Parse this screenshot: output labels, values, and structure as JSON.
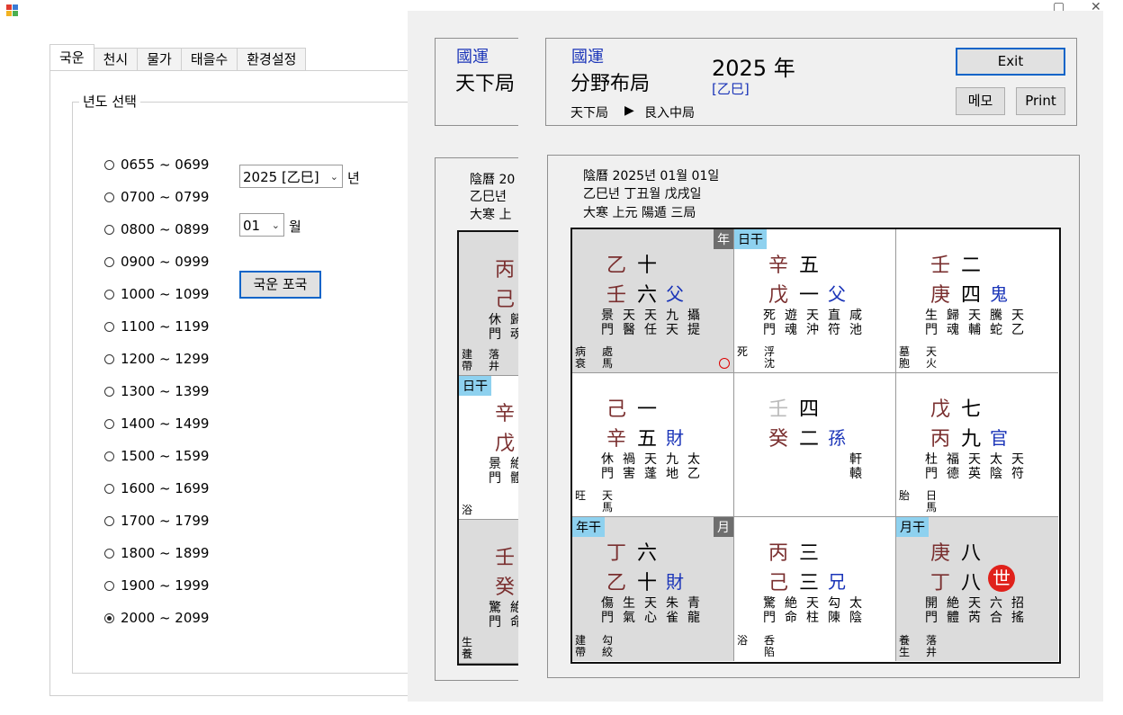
{
  "tabs": [
    "국운",
    "천시",
    "물가",
    "태을수",
    "환경설정"
  ],
  "group_title": "년도 선택",
  "ranges": [
    "0655 ~ 0699",
    "0700 ~ 0799",
    "0800 ~ 0899",
    "0900 ~ 0999",
    "1000 ~ 1099",
    "1100 ~ 1199",
    "1200 ~ 1299",
    "1300 ~ 1399",
    "1400 ~ 1499",
    "1500 ~ 1599",
    "1600 ~ 1699",
    "1700 ~ 1799",
    "1800 ~ 1899",
    "1900 ~ 1999",
    "2000 ~ 2099"
  ],
  "year_select": "2025 [乙巳]",
  "year_unit": "년",
  "month_select": "01",
  "month_unit": "월",
  "calc_button": "국운 포국",
  "back": {
    "title_small": "國運",
    "title_big": "天下局",
    "info1": "陰曆 20",
    "info2": "乙巳년",
    "info3": "大寒 上"
  },
  "front": {
    "title_small": "國運",
    "title_big": "分野布局",
    "year": "2025 年",
    "year_gz": "[乙巳]",
    "sub_left": "天下局",
    "sub_arrow": "▶",
    "sub_right": "艮入中局",
    "exit": "Exit",
    "memo": "메모",
    "print": "Print",
    "info1": "陰曆 2025년 01월 01일",
    "info2": "乙巳년 丁丑월 戊戌일",
    "info3": "大寒 上元 陽遁 三局"
  },
  "cells": [
    {
      "tagl": "",
      "tagr": "年",
      "s1": "乙",
      "n1": "十",
      "s2": "壬",
      "n2": "六",
      "rel": "父",
      "gods": [
        "景門",
        "天醫",
        "天任",
        "九天",
        "攝提"
      ],
      "foot": [
        "病衰",
        "處馬"
      ],
      "gray": true,
      "ring": true
    },
    {
      "tagl": "日干",
      "tagr": "",
      "s1": "辛",
      "n1": "五",
      "s2": "戊",
      "n2": "一",
      "rel": "父",
      "gods": [
        "死門",
        "遊魂",
        "天沖",
        "直符",
        "咸池"
      ],
      "foot": [
        "死",
        "浮沈"
      ],
      "gray": false
    },
    {
      "tagl": "",
      "tagr": "",
      "s1": "壬",
      "n1": "二",
      "s2": "庚",
      "n2": "四",
      "rel": "鬼",
      "gods": [
        "生門",
        "歸魂",
        "天輔",
        "騰蛇",
        "天乙"
      ],
      "foot": [
        "墓胞",
        "天火"
      ],
      "gray": false
    },
    {
      "tagl": "",
      "tagr": "",
      "s1": "己",
      "n1": "一",
      "s2": "辛",
      "n2": "五",
      "rel": "財",
      "gods": [
        "休門",
        "禍害",
        "天蓬",
        "九地",
        "太乙"
      ],
      "foot": [
        "旺",
        "天馬"
      ],
      "gray": false
    },
    {
      "tagl": "",
      "tagr": "",
      "s1": "壬",
      "n1": "四",
      "s2": "癸",
      "n2": "二",
      "rel": "孫",
      "gods": [
        "",
        "",
        "",
        "",
        "軒轅"
      ],
      "foot": [
        "",
        ""
      ],
      "gray": false,
      "center": true
    },
    {
      "tagl": "",
      "tagr": "",
      "s1": "戊",
      "n1": "七",
      "s2": "丙",
      "n2": "九",
      "rel": "官",
      "gods": [
        "杜門",
        "福德",
        "天英",
        "太陰",
        "天符"
      ],
      "foot": [
        "胎",
        "日馬"
      ],
      "gray": false
    },
    {
      "tagl": "年干",
      "tagr": "月",
      "s1": "丁",
      "n1": "六",
      "s2": "乙",
      "n2": "十",
      "rel": "財",
      "gods": [
        "傷門",
        "生氣",
        "天心",
        "朱雀",
        "青龍"
      ],
      "foot": [
        "建帶",
        "勾絞"
      ],
      "gray": true
    },
    {
      "tagl": "",
      "tagr": "",
      "s1": "丙",
      "n1": "三",
      "s2": "己",
      "n2": "三",
      "rel": "兄",
      "gods": [
        "驚門",
        "絶命",
        "天柱",
        "勾陳",
        "太陰"
      ],
      "foot": [
        "浴",
        "呑陷"
      ],
      "gray": false
    },
    {
      "tagl": "月干",
      "tagr": "",
      "s1": "庚",
      "n1": "八",
      "s2": "丁",
      "n2": "八",
      "rel": "世",
      "gods": [
        "開門",
        "絶體",
        "天芮",
        "六合",
        "招搖"
      ],
      "foot": [
        "養生",
        "落井"
      ],
      "gray": true,
      "seal": true
    }
  ],
  "back_cells": [
    {
      "s1": "丙",
      "s2": "己",
      "g": [
        "休門",
        "歸魂"
      ],
      "foot": [
        "建帶",
        "落井"
      ],
      "tag": ""
    },
    {
      "s1": "辛",
      "s2": "戊",
      "g": [
        "景門",
        "絶體"
      ],
      "foot": [
        "浴",
        ""
      ],
      "tag": "日干"
    },
    {
      "s1": "壬",
      "s2": "癸",
      "g": [
        "驚門",
        "絶命"
      ],
      "foot": [
        "生養",
        ""
      ],
      "tag": ""
    }
  ]
}
